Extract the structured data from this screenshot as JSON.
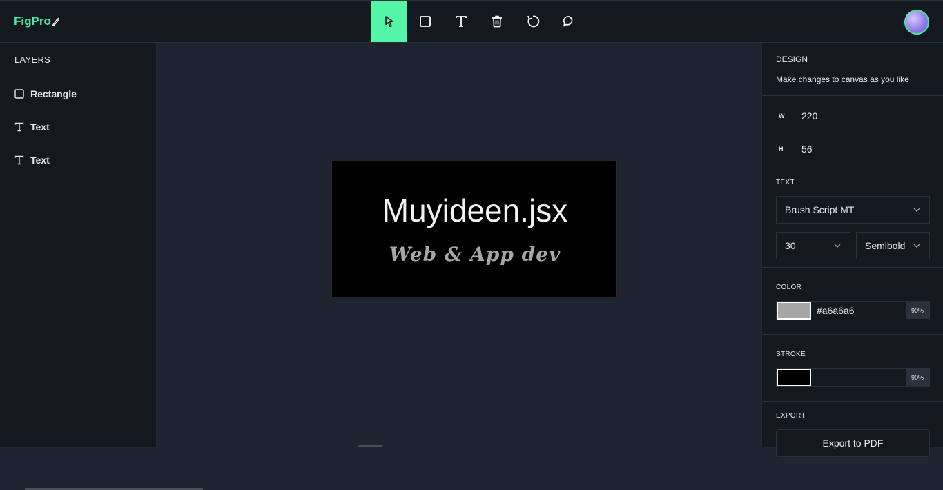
{
  "app": {
    "logo_text": "FigPro"
  },
  "toolbar": {
    "tools": [
      {
        "name": "select",
        "icon": "cursor-icon",
        "active": true
      },
      {
        "name": "rectangle",
        "icon": "square-icon",
        "active": false
      },
      {
        "name": "text",
        "icon": "text-icon",
        "active": false
      },
      {
        "name": "delete",
        "icon": "trash-icon",
        "active": false
      },
      {
        "name": "reset",
        "icon": "reset-icon",
        "active": false
      },
      {
        "name": "comment",
        "icon": "comment-icon",
        "active": false
      }
    ],
    "accent": "#55f5a8"
  },
  "layers": {
    "header": "LAYERS",
    "items": [
      {
        "label": "Rectangle",
        "icon": "square-icon"
      },
      {
        "label": "Text",
        "icon": "text-icon"
      },
      {
        "label": "Text",
        "icon": "text-icon"
      }
    ]
  },
  "canvas": {
    "title": "Muyideen.jsx",
    "subtitle": "Web & App dev",
    "background": "#000000"
  },
  "design": {
    "title": "DESIGN",
    "description": "Make changes to canvas as you like",
    "width_label": "W",
    "width_value": "220",
    "height_label": "H",
    "height_value": "56",
    "text_section": "TEXT",
    "font_family": "Brush Script MT",
    "font_size": "30",
    "font_weight": "Semibold",
    "color_section": "COLOR",
    "color_hex": "#a6a6a6",
    "color_opacity": "90%",
    "stroke_section": "STROKE",
    "stroke_color": "#000000",
    "stroke_opacity": "90%",
    "export_section": "EXPORT",
    "export_button": "Export to PDF"
  }
}
